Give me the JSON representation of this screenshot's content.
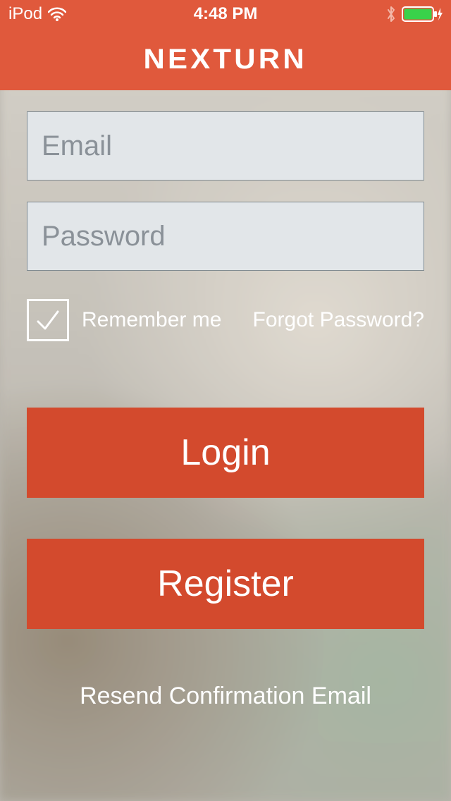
{
  "status": {
    "device": "iPod",
    "time": "4:48 PM"
  },
  "brand": "NEXTURN",
  "form": {
    "email_placeholder": "Email",
    "email_value": "",
    "password_placeholder": "Password",
    "password_value": "",
    "remember_label": "Remember me",
    "remember_checked": true,
    "forgot_label": "Forgot Password?",
    "login_label": "Login",
    "register_label": "Register",
    "resend_label": "Resend Confirmation Email"
  },
  "colors": {
    "accent": "#e0593c",
    "button": "#d34a2d",
    "input_bg": "#e2e6e9",
    "input_border": "#7f8a90"
  }
}
